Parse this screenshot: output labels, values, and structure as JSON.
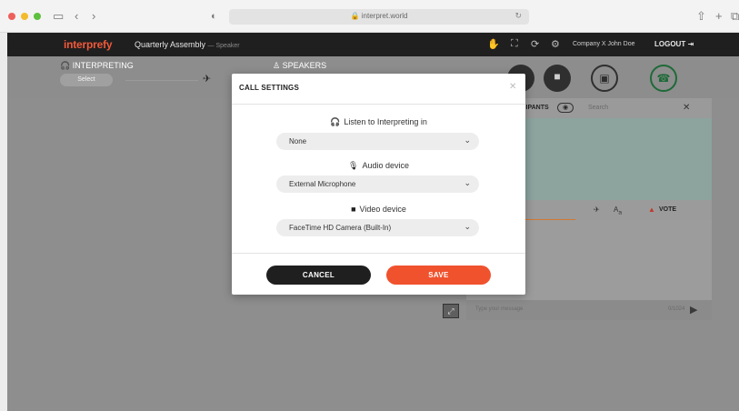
{
  "browser": {
    "url": "interpret.world",
    "lock_glyph": "🔒"
  },
  "header": {
    "brand": "interprefy",
    "room": "Quarterly Assembly",
    "room_role": "— Speaker",
    "user": "Company X John Doe",
    "logout": "LOGOUT"
  },
  "toolbar": {
    "interpreting_label": "INTERPRETING",
    "interpreting_select": "Select",
    "speakers_label": "SPEAKERS"
  },
  "participants_panel": {
    "title": "PARTICIPANTS",
    "search_placeholder": "Search",
    "vote_label": "VOTE",
    "message_placeholder": "Type your message",
    "message_limit": "0/1024"
  },
  "modal": {
    "title": "CALL SETTINGS",
    "listen_label": "Listen to Interpreting in",
    "listen_value": "None",
    "audio_label": "Audio device",
    "audio_value": "External Microphone",
    "video_label": "Video device",
    "video_value": "FaceTime HD Camera (Built-In)",
    "cancel_label": "CANCEL",
    "save_label": "SAVE"
  },
  "colors": {
    "brand": "#f0593a",
    "save": "#f0522e",
    "cancel": "#1f1f1f",
    "hangup": "#1e6a38"
  }
}
